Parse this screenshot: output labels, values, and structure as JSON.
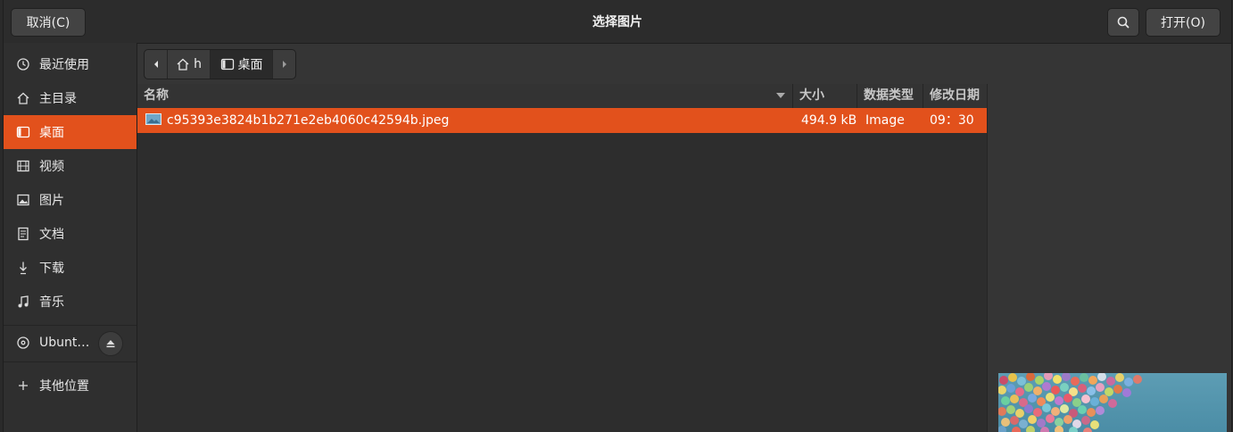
{
  "header": {
    "cancel_label": "取消(C)",
    "title": "选择图片",
    "open_label": "打开(O)"
  },
  "sidebar": {
    "items": [
      {
        "label": "最近使用",
        "icon": "clock-icon"
      },
      {
        "label": "主目录",
        "icon": "home-icon"
      },
      {
        "label": "桌面",
        "icon": "desktop-icon",
        "active": true
      },
      {
        "label": "视频",
        "icon": "film-icon"
      },
      {
        "label": "图片",
        "icon": "picture-icon"
      },
      {
        "label": "文档",
        "icon": "document-icon"
      },
      {
        "label": "下载",
        "icon": "download-icon"
      },
      {
        "label": "音乐",
        "icon": "music-icon"
      }
    ],
    "device": {
      "label": "Ubunt…",
      "icon": "disc-icon"
    },
    "other": {
      "label": "其他位置",
      "icon": "plus-icon"
    }
  },
  "pathbar": {
    "home_label": "h",
    "current_label": "桌面"
  },
  "list": {
    "columns": {
      "name": "名称",
      "size": "大小",
      "type": "数据类型",
      "modified": "修改日期"
    },
    "rows": [
      {
        "name": "c95393e3824b1b271e2eb4060c42594b.jpeg",
        "size": "494.9 kB",
        "type": "Image",
        "modified": "09：30",
        "selected": true
      }
    ]
  },
  "colors": {
    "accent": "#e2511c",
    "background": "#353535"
  }
}
